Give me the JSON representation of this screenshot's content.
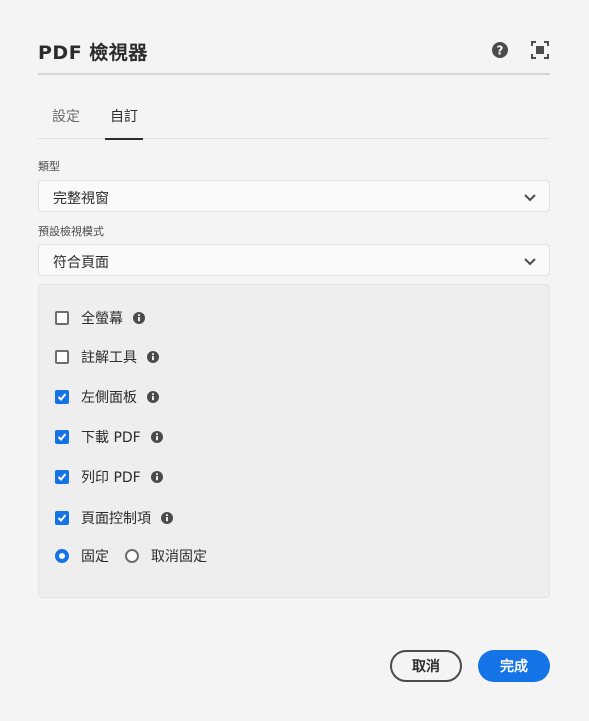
{
  "dialog": {
    "title": "PDF 檢視器",
    "help_icon": "help-icon",
    "fullscreen_icon": "fullscreen-icon"
  },
  "tabs": [
    {
      "label": "設定",
      "selected": false
    },
    {
      "label": "自訂",
      "selected": true
    }
  ],
  "type_field": {
    "label": "類型",
    "value": "完整視窗"
  },
  "view_mode_field": {
    "label": "預設檢視模式",
    "value": "符合頁面"
  },
  "options": [
    {
      "label": "全螢幕",
      "checked": false
    },
    {
      "label": "註解工具",
      "checked": false
    },
    {
      "label": "左側面板",
      "checked": true
    },
    {
      "label": "下載 PDF",
      "checked": true
    },
    {
      "label": "列印 PDF",
      "checked": true
    },
    {
      "label": "頁面控制項",
      "checked": true
    }
  ],
  "dock": {
    "docked_label": "固定",
    "undocked_label": "取消固定",
    "selected": "docked"
  },
  "buttons": {
    "cancel": "取消",
    "done": "完成"
  },
  "colors": {
    "accent": "#1473e6",
    "background": "#f4f4f4",
    "panel": "#eeeeee"
  }
}
